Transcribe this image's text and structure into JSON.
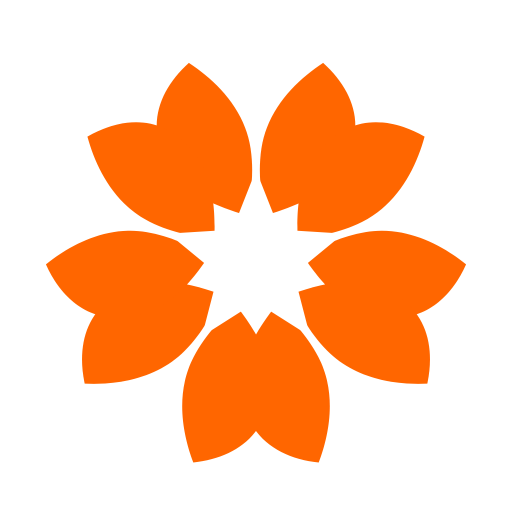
{
  "logo": {
    "icon": "star-flower-icon",
    "petal_count": 10,
    "colors": {
      "petal": "#FF6600",
      "background": "#FFFFFF",
      "star": "#FFFFFF"
    }
  }
}
